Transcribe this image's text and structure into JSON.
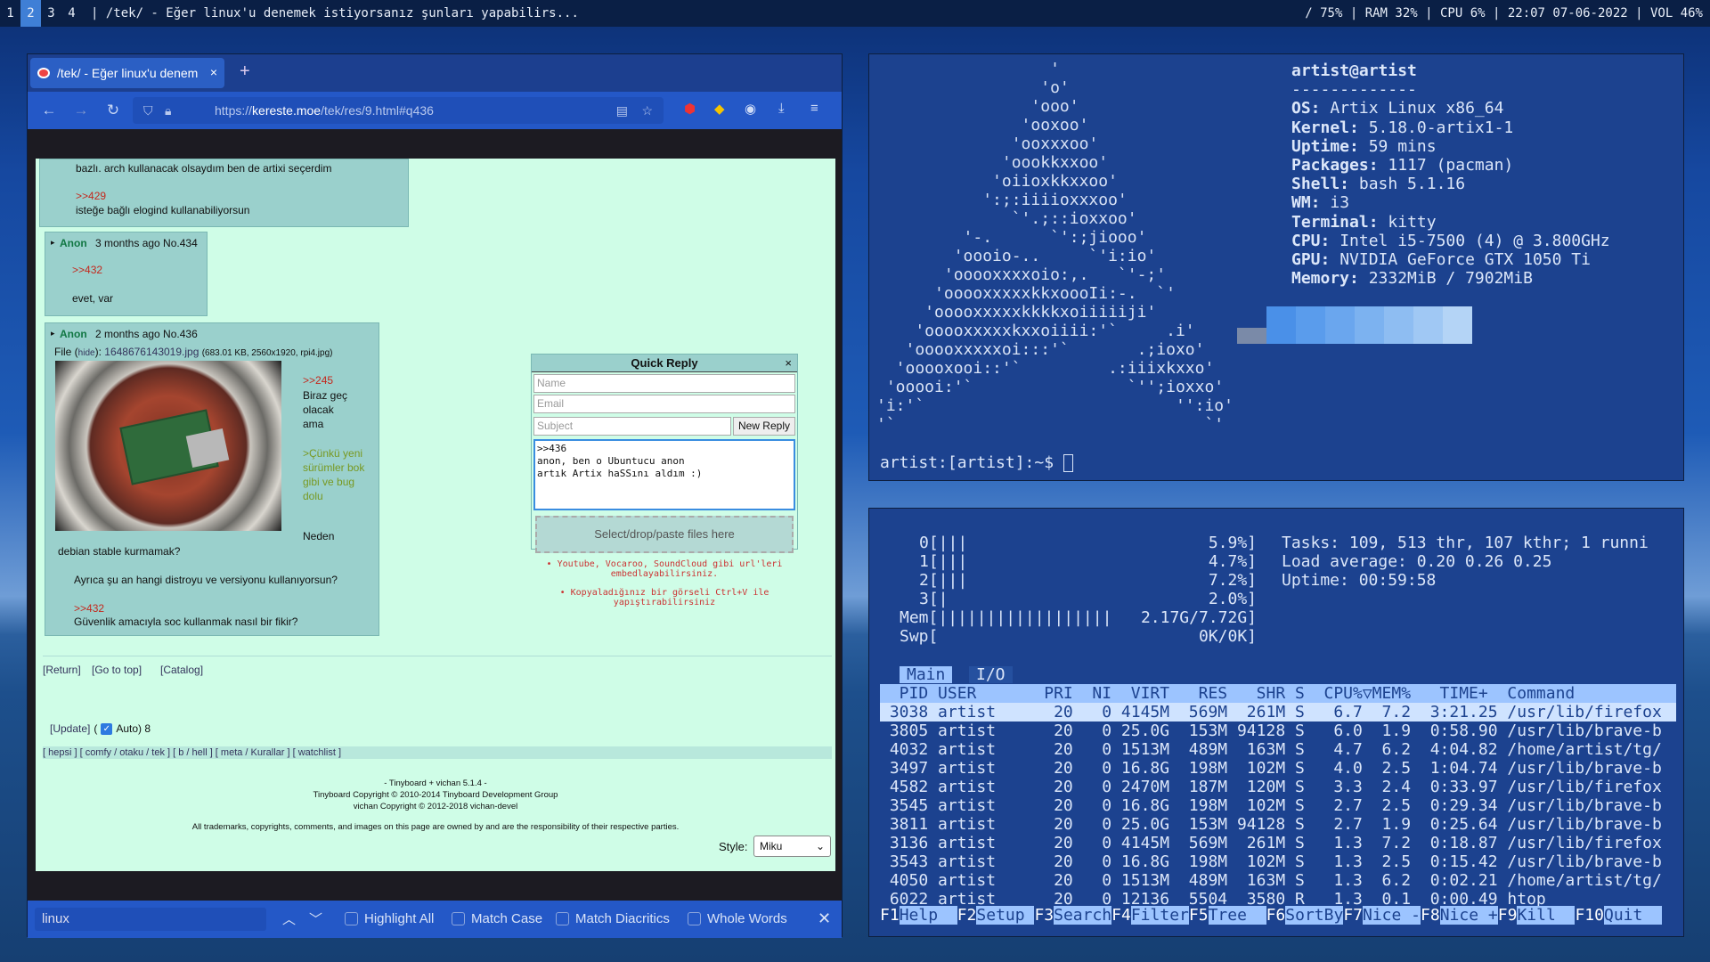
{
  "bar": {
    "workspaces": [
      "1",
      "2",
      "3",
      "4"
    ],
    "active_workspace": "2",
    "title": "| /tek/ - Eğer linux'u denemek istiyorsanız şunları yapabilirs...",
    "status": "/ 75% | RAM 32% | CPU  6% | 22:07 07-06-2022 | VOL 46%"
  },
  "browser": {
    "tab_title": "/tek/ - Eğer linux'u denem",
    "tab_close": "×",
    "new_tab": "+",
    "url_host": "kereste.moe",
    "url_prefix": "https://",
    "url_path": "/tek/res/9.html#q436",
    "posts": {
      "p0_line1": "bazlı. arch kullanacak olsaydım ben de artixi seçerdim",
      "p0_quote": ">>429",
      "p0_line2": "isteğe bağlı elogind kullanabiliyorsun",
      "p434_name": "Anon",
      "p434_meta": "3 months ago No.434",
      "p434_quote": ">>432",
      "p434_text": "evet, var",
      "p436_name": "Anon",
      "p436_meta": "2 months ago No.436",
      "p436_file_label": "File (",
      "p436_hide": "hide",
      "p436_file_close": "):",
      "p436_filename": "1648676143019.jpg",
      "p436_fileinfo": "(683.01 KB, 2560x1920, rpi4.jpg)",
      "p436_q1": ">>245",
      "p436_t1": "Biraz geç olacak ama",
      "p436_gt": ">Çünkü yeni sürümler bok gibi ve bug dolu",
      "p436_t2": "Neden",
      "p436_t3": "debian stable kurmamak?",
      "p436_t4": "Ayrıca şu an hangi distroyu ve versiyonu kullanıyorsun?",
      "p436_q2": ">>432",
      "p436_t5": "Güvenlik amacıyla soc kullanmak nasıl bir fikir?"
    },
    "links": {
      "ret": "[Return]",
      "top": "[Go to top]",
      "catalog": "[Catalog]",
      "update": "[Update]",
      "auto": "Auto) 8",
      "boards": "[ hepsi ] [ comfy / otaku / tek ] [ b / hell ] [ meta / Kurallar ] [ watchlist ]"
    },
    "footer": {
      "l1": "- Tinyboard + vichan 5.1.4 -",
      "l2": "Tinyboard Copyright © 2010-2014 Tinyboard Development Group",
      "l3": "vichan Copyright © 2012-2018 vichan-devel",
      "l4": "All trademarks, copyrights, comments, and images on this page are owned by and are the responsibility of their respective parties.",
      "style_label": "Style:",
      "style_value": "Miku"
    },
    "quick_reply": {
      "title": "Quick Reply",
      "close": "×",
      "name_ph": "Name",
      "email_ph": "Email",
      "subject_ph": "Subject",
      "button": "New Reply",
      "body": ">>436\nanon, ben o Ubuntucu anon\nartık Artix haSSını aldım :)",
      "drop": "Select/drop/paste files here",
      "note1": "• Youtube, Vocaroo, SoundCloud gibi url'leri embedlayabilirsiniz.",
      "note2": "• Kopyaladığınız bir görseli Ctrl+V ile yapıştırabilirsiniz"
    },
    "find": {
      "query": "linux",
      "highlight": "Highlight All",
      "match_case": "Match Case",
      "diacritics": "Match Diacritics",
      "whole": "Whole Words"
    }
  },
  "neofetch": {
    "art": "                  '\n                 'o'\n                'ooo'\n               'ooxoo'\n              'ooxxxoo'\n             'oookkxxoo'\n            'oiioxkkxxoo'\n           ':;:iiiioxxxoo'\n              `'.;::ioxxoo'\n         '-.      `':;jiooo'\n        'oooio-..     `'i:io'\n       'ooooxxxxoio:,.   `'-;'\n      'ooooxxxxxkkxoooIi:-.  `'\n     'ooooxxxxxkkkkxoiiiiiji'\n    'ooooxxxxxkxxoiiii:'`     .i'\n   'ooooxxxxxoi:::'`       .;ioxo'\n  'ooooxooi::'`         .:iiixkxxo'\n 'ooooi:'`                `'';ioxxo'\n'i:'`                          '':io'\n'`                                `'",
    "user": "artist@artist",
    "sep": "-------------",
    "fields": [
      {
        "k": "OS",
        "v": "Artix Linux x86_64"
      },
      {
        "k": "Kernel",
        "v": "5.18.0-artix1-1"
      },
      {
        "k": "Uptime",
        "v": "59 mins"
      },
      {
        "k": "Packages",
        "v": "1117 (pacman)"
      },
      {
        "k": "Shell",
        "v": "bash 5.1.16"
      },
      {
        "k": "WM",
        "v": "i3"
      },
      {
        "k": "Terminal",
        "v": "kitty"
      },
      {
        "k": "CPU",
        "v": "Intel i5-7500 (4) @ 3.800GHz"
      },
      {
        "k": "GPU",
        "v": "NVIDIA GeForce GTX 1050 Ti"
      },
      {
        "k": "Memory",
        "v": "2332MiB / 7902MiB"
      }
    ],
    "swatches": [
      "#7a8aa8",
      "#4a90e8",
      "#5a9cec",
      "#6aa6ee",
      "#7cb2f0",
      "#8ebdf2",
      "#a0c8f4",
      "#b4d4f6"
    ],
    "prompt": "artist:[artist]:~$ "
  },
  "htop": {
    "cpu": [
      {
        "label": "0",
        "bar": "[|||",
        "pct": "5.9%]"
      },
      {
        "label": "1",
        "bar": "[|||",
        "pct": "4.7%]"
      },
      {
        "label": "2",
        "bar": "[|||",
        "pct": "7.2%]"
      },
      {
        "label": "3",
        "bar": "[|",
        "pct": "2.0%]"
      }
    ],
    "mem": {
      "label": "Mem",
      "bar": "[||||||||||||||||||",
      "val": "2.17G/7.72G]"
    },
    "swp": {
      "label": "Swp",
      "bar": "[",
      "val": "0K/0K]"
    },
    "tasks": "Tasks: 109, 513 thr, 107 kthr; 1 runni",
    "load": "Load average: 0.20 0.26 0.25",
    "uptime": "Uptime: 00:59:58",
    "tab_main": "Main",
    "tab_io": "I/O",
    "header": "  PID USER       PRI  NI  VIRT   RES   SHR S  CPU%▽MEM%   TIME+  Command",
    "rows": [
      " 3038 artist      20   0 4145M  569M  261M S   6.7  7.2  3:21.25 /usr/lib/firefox",
      " 3805 artist      20   0 25.0G  153M 94128 S   6.0  1.9  0:58.90 /usr/lib/brave-b",
      " 4032 artist      20   0 1513M  489M  163M S   4.7  6.2  4:04.82 /home/artist/tg/",
      " 3497 artist      20   0 16.8G  198M  102M S   4.0  2.5  1:04.74 /usr/lib/brave-b",
      " 4582 artist      20   0 2470M  187M  120M S   3.3  2.4  0:33.97 /usr/lib/firefox",
      " 3545 artist      20   0 16.8G  198M  102M S   2.7  2.5  0:29.34 /usr/lib/brave-b",
      " 3811 artist      20   0 25.0G  153M 94128 S   2.7  1.9  0:25.64 /usr/lib/brave-b",
      " 3136 artist      20   0 4145M  569M  261M S   1.3  7.2  0:18.87 /usr/lib/firefox",
      " 3543 artist      20   0 16.8G  198M  102M S   1.3  2.5  0:15.42 /usr/lib/brave-b",
      " 4050 artist      20   0 1513M  489M  163M S   1.3  6.2  0:02.21 /home/artist/tg/",
      " 6022 artist      20   0 12136  5504  3580 R   1.3  0.1  0:00.49 htop"
    ],
    "fkeys": [
      {
        "k": "F1",
        "v": "Help  "
      },
      {
        "k": "F2",
        "v": "Setup "
      },
      {
        "k": "F3",
        "v": "Search"
      },
      {
        "k": "F4",
        "v": "Filter"
      },
      {
        "k": "F5",
        "v": "Tree  "
      },
      {
        "k": "F6",
        "v": "SortBy"
      },
      {
        "k": "F7",
        "v": "Nice -"
      },
      {
        "k": "F8",
        "v": "Nice +"
      },
      {
        "k": "F9",
        "v": "Kill  "
      },
      {
        "k": "F10",
        "v": "Quit  "
      }
    ]
  }
}
